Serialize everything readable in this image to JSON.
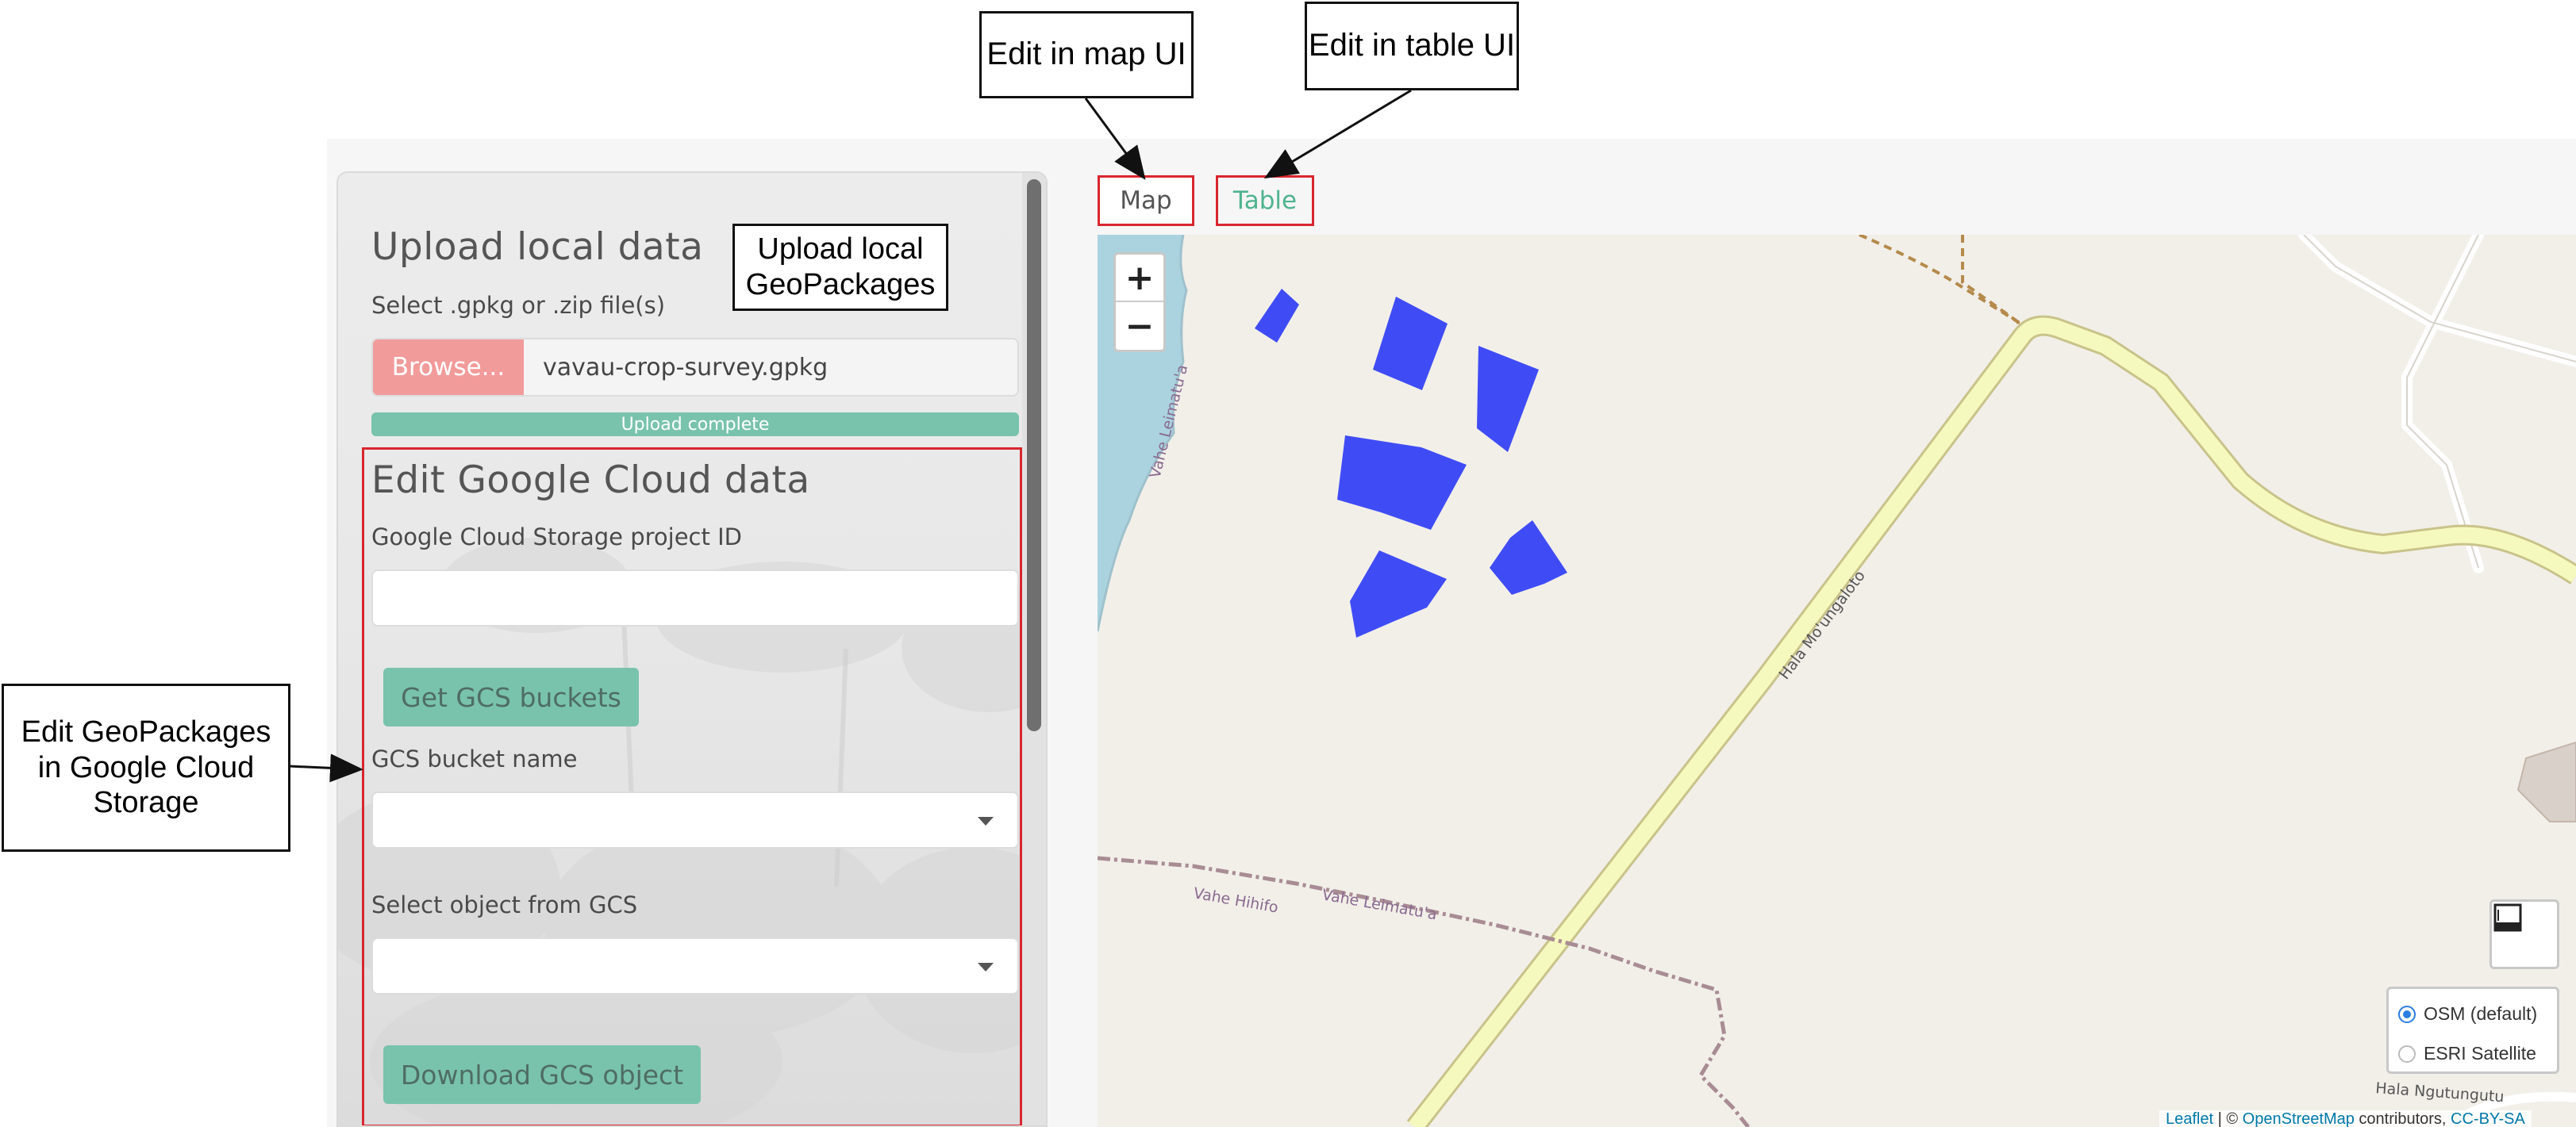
{
  "annotations": {
    "edit_map_ui": "Edit in map UI",
    "edit_table_ui": "Edit in table UI",
    "upload_local_line1": "Upload local",
    "upload_local_line2": "GeoPackages",
    "edit_gcs_line1": "Edit GeoPackages",
    "edit_gcs_line2": "in Google Cloud",
    "edit_gcs_line3": "Storage"
  },
  "sidebar": {
    "upload_title": "Upload local data",
    "file_label": "Select .gpkg or .zip file(s)",
    "browse_label": "Browse...",
    "file_name": "vavau-crop-survey.gpkg",
    "upload_status": "Upload complete",
    "gcs_title": "Edit Google Cloud data",
    "project_id_label": "Google Cloud Storage project ID",
    "project_id_value": "",
    "get_buckets_label": "Get GCS buckets",
    "bucket_label": "GCS bucket name",
    "bucket_value": "",
    "object_label": "Select object from GCS",
    "object_value": "",
    "download_label": "Download GCS object"
  },
  "tabs": [
    {
      "label": "Map",
      "active": true
    },
    {
      "label": "Table",
      "active": false
    }
  ],
  "map": {
    "zoom_in": "+",
    "zoom_out": "−",
    "road_labels": [
      "Hala Mo'ungaloto",
      "Vahe Leimatu'a",
      "Vahe Leimatu'a",
      "Vahe Hihifo",
      "Hala Ngutungutu"
    ],
    "layers": [
      {
        "label": "OSM (default)",
        "selected": true
      },
      {
        "label": "ESRI Satellite",
        "selected": false
      }
    ],
    "attribution": {
      "leaflet": "Leaflet",
      "separator": " | © ",
      "osm": "OpenStreetMap",
      "contributors": " contributors, ",
      "license": "CC-BY-SA"
    },
    "polygon_color": "#3f4cf5",
    "water_color": "#aad3df",
    "road_color": "#f6f9be"
  },
  "colors": {
    "accent_green": "#79c3ad",
    "tab_green": "#4fb38f",
    "browse_red": "#f29b9b",
    "highlight_red": "#d9262f"
  }
}
